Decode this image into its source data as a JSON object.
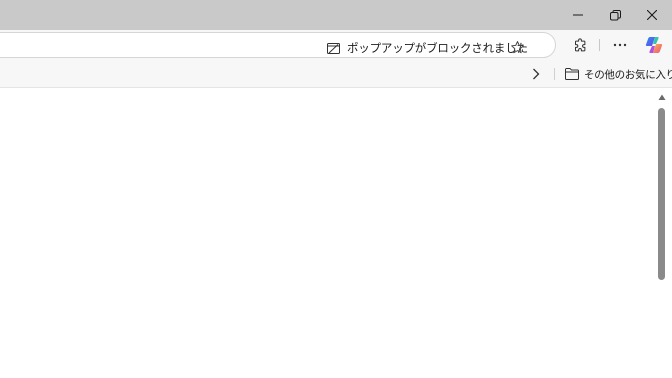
{
  "window": {
    "minimize_icon": "minimize-icon",
    "restore_icon": "restore-icon",
    "close_icon": "close-icon"
  },
  "toolbar": {
    "popup_blocked_text": "ポップアップがブロックされました",
    "popup_blocked_icon": "popup-blocked-icon",
    "favorite_icon": "star-icon",
    "extensions_icon": "puzzle-icon",
    "more_icon": "more-icon",
    "copilot_icon": "copilot-icon"
  },
  "favorites_bar": {
    "chevron_icon": "chevron-right-icon",
    "other_favorites_label": "その他のお気に入り",
    "folder_icon": "folder-icon"
  },
  "colors": {
    "titlebar": "#c9c9c9",
    "toolbar": "#f7f7f7",
    "scroll_thumb": "#8a8a8a"
  }
}
